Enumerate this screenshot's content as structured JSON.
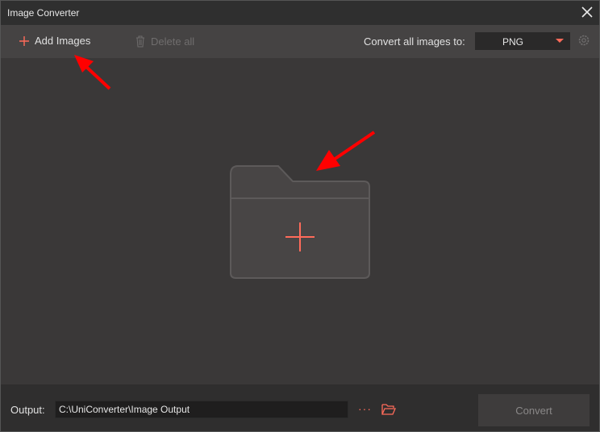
{
  "window": {
    "title": "Image Converter"
  },
  "toolbar": {
    "add_images_label": "Add Images",
    "delete_all_label": "Delete all",
    "convert_all_label": "Convert all images to:",
    "format_selected": "PNG"
  },
  "bottom": {
    "output_label": "Output:",
    "output_path": "C:\\UniConverter\\Image Output",
    "more_label": "···",
    "convert_label": "Convert"
  },
  "colors": {
    "accent": "#ff6b5a",
    "annotation_arrow": "#ff0000",
    "background": "#3a3838",
    "toolbar": "#454343"
  },
  "icons": {
    "close": "close-icon",
    "add": "plus-icon",
    "delete": "trash-icon",
    "settings": "gear-icon",
    "drop_zone": "folder-plus-icon",
    "browse": "folder-open-icon"
  }
}
